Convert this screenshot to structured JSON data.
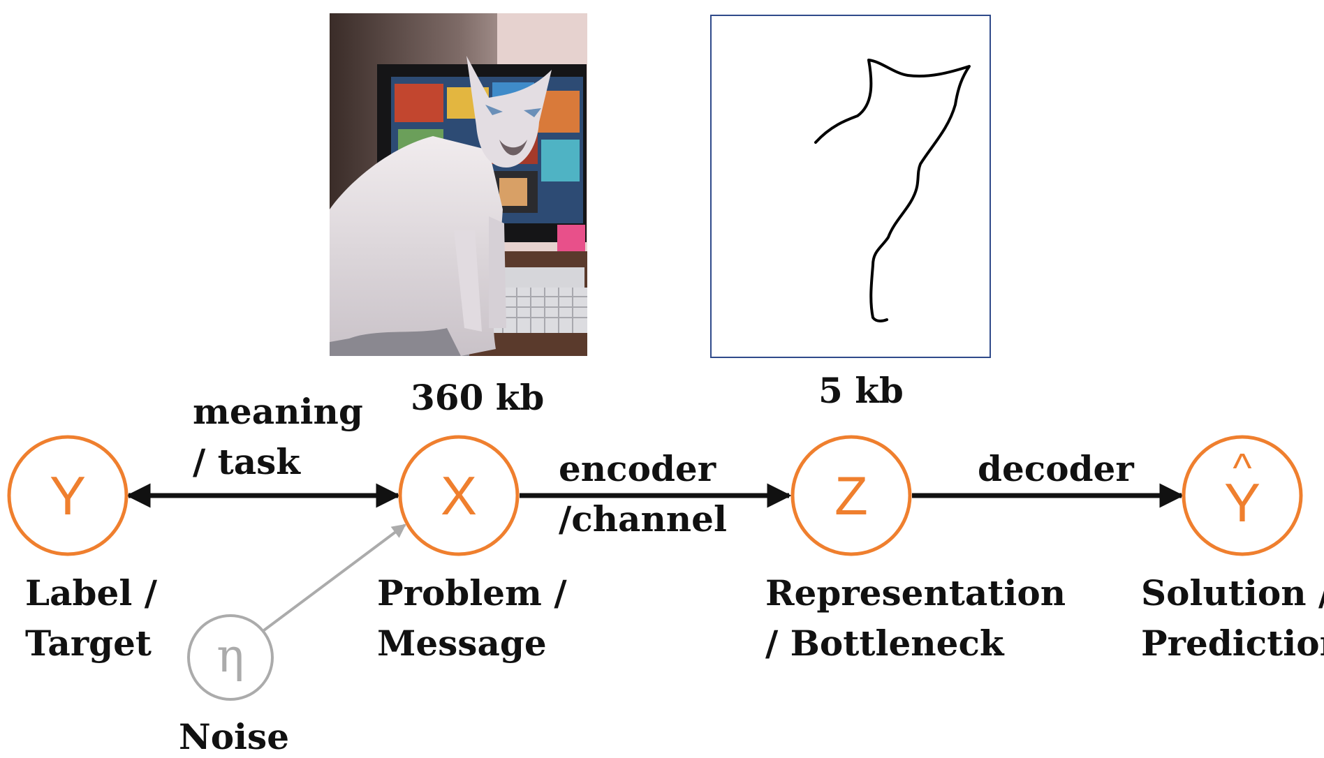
{
  "colors": {
    "node_stroke": "#ef7f2e",
    "node_text": "#ef7f2e",
    "noise": "#ababab",
    "arrow": "#111111",
    "sketch_frame": "#2f4a8a"
  },
  "images": {
    "photo_icon": "siamese-cat-photo",
    "photo_size": "360 kb",
    "sketch_icon": "cat-outline-sketch",
    "sketch_size": "5 kb"
  },
  "nodes": {
    "y": {
      "symbol": "Y",
      "label_line1": "Label /",
      "label_line2": "Target"
    },
    "x": {
      "symbol": "X",
      "label_line1": "Problem /",
      "label_line2": "Message"
    },
    "z": {
      "symbol": "Z",
      "label_line1": "Representation",
      "label_line2": "/ Bottleneck"
    },
    "yhat": {
      "symbol": "Y",
      "hat": "^",
      "label_line1": "Solution /",
      "label_line2": "Prediction"
    },
    "noise": {
      "symbol": "η",
      "label": "Noise"
    }
  },
  "edges": {
    "y_x": {
      "line1": "meaning",
      "line2": "/ task"
    },
    "x_z": {
      "line1": "encoder",
      "line2": "/channel"
    },
    "z_yhat": {
      "line1": "decoder"
    }
  }
}
